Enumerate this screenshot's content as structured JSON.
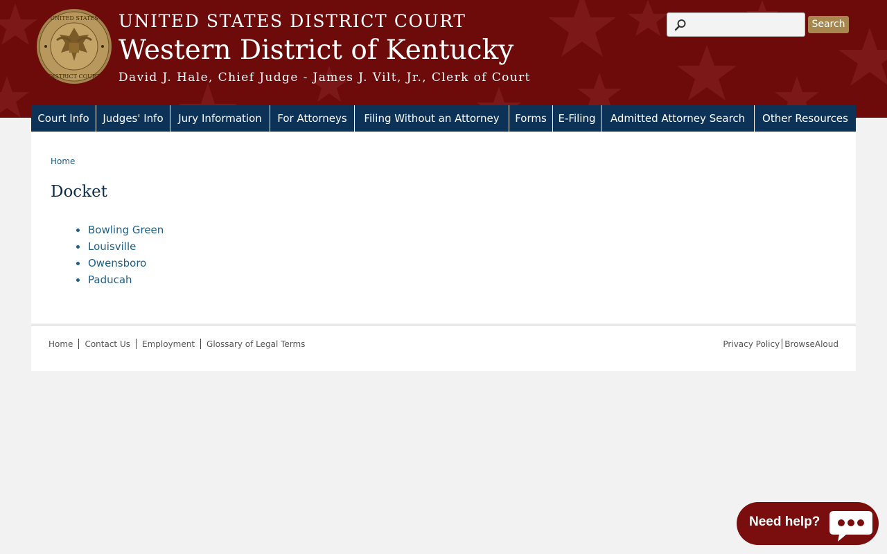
{
  "header": {
    "court": "UNITED STATES DISTRICT COURT",
    "district": "Western District of Kentucky",
    "officials": "David J. Hale, Chief Judge - James J. Vilt, Jr., Clerk of Court",
    "seal_text_top": "UNITED STATES",
    "seal_text_bottom": "DISTRICT COURT",
    "search_placeholder": "",
    "search_button": "Search",
    "search_icon": "magnifier-icon",
    "colors": {
      "banner": "#6d0a0a",
      "search_button": "#a8874f"
    }
  },
  "nav": {
    "color": "#0d3258",
    "items": [
      {
        "label": "Court Info"
      },
      {
        "label": "Judges' Info"
      },
      {
        "label": "Jury Information"
      },
      {
        "label": "For Attorneys"
      },
      {
        "label": "Filing Without an Attorney"
      },
      {
        "label": "Forms"
      },
      {
        "label": "E-Filing"
      },
      {
        "label": "Admitted Attorney Search"
      },
      {
        "label": "Other Resources"
      }
    ]
  },
  "breadcrumb": "Home",
  "page_title": "Docket",
  "docket_links": [
    "Bowling Green",
    "Louisville",
    "Owensboro",
    "Paducah"
  ],
  "footer": {
    "left_links": [
      "Home",
      "Contact Us",
      "Employment",
      "Glossary of Legal Terms"
    ],
    "right_links": [
      "Privacy Policy",
      "BrowseAloud"
    ]
  },
  "chat": {
    "label": "Need help?",
    "icon": "chat-bubble-icon",
    "color": "#7a0d0d"
  }
}
